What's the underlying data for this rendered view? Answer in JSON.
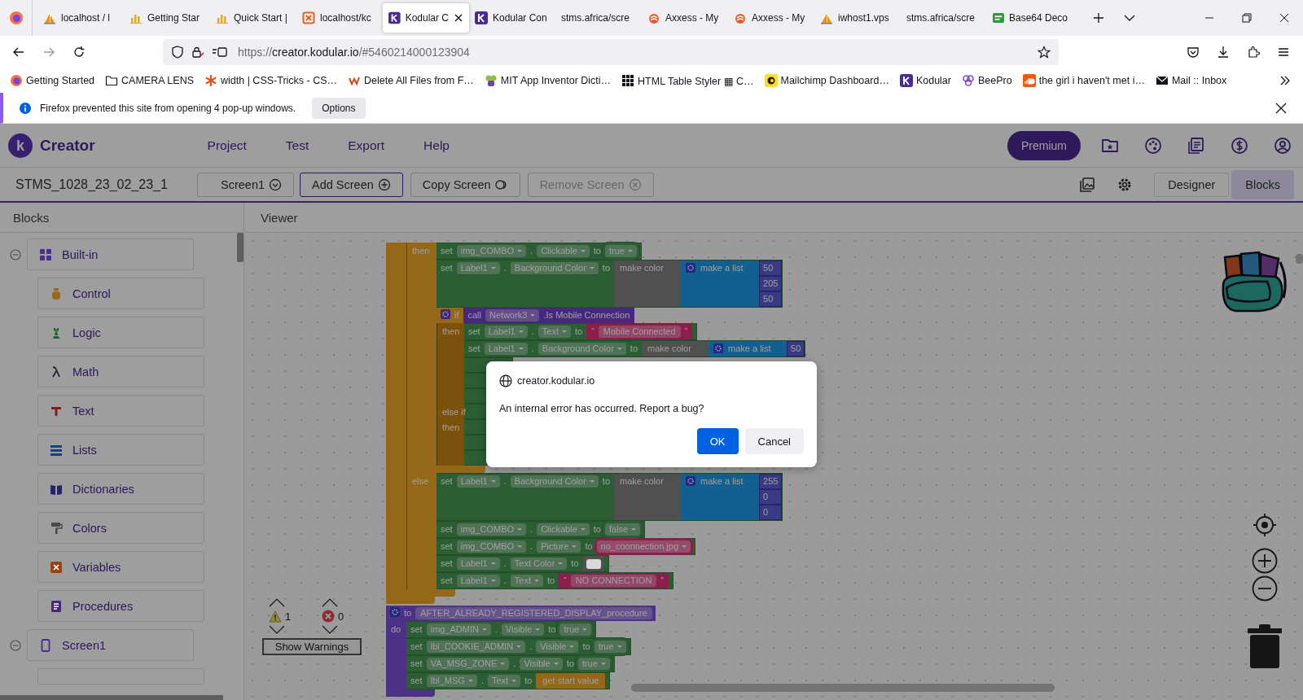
{
  "browser": {
    "tabs": [
      {
        "kind": "pma",
        "title": "localhost / l",
        "selected": false
      },
      {
        "kind": "chart",
        "title": "Getting Star",
        "selected": false
      },
      {
        "kind": "chart",
        "title": "Quick Start |",
        "selected": false
      },
      {
        "kind": "box",
        "title": "localhost/kc",
        "selected": false
      },
      {
        "kind": "kodular",
        "title": "Kodular C",
        "selected": true
      },
      {
        "kind": "kodular",
        "title": "Kodular Con",
        "selected": false
      },
      {
        "kind": "none",
        "title": "stms.africa/scre",
        "selected": false
      },
      {
        "kind": "flame",
        "title": "Axxess - My",
        "selected": false
      },
      {
        "kind": "flame",
        "title": "Axxess - My",
        "selected": false
      },
      {
        "kind": "pma",
        "title": "iwhost1.vps",
        "selected": false
      },
      {
        "kind": "none",
        "title": "stms.africa/scre",
        "selected": false
      },
      {
        "kind": "b64",
        "title": "Base64 Deco",
        "selected": false
      }
    ],
    "url": {
      "scheme": "https://",
      "domain": "creator.kodular.io",
      "path": "/#5460214000123904"
    },
    "bookmarks": [
      {
        "kind": "firefox",
        "label": "Getting Started"
      },
      {
        "kind": "folder",
        "label": "CAMERA LENS"
      },
      {
        "kind": "star",
        "label": "width | CSS-Tricks - CS…"
      },
      {
        "kind": "cw",
        "label": "Delete All Files from F…"
      },
      {
        "kind": "mit",
        "label": "MIT App Inventor Dicti…"
      },
      {
        "kind": "grid",
        "label": "HTML Table Styler ▦ C…"
      },
      {
        "kind": "mailchimp",
        "label": "Mailchimp Dashboard…"
      },
      {
        "kind": "kodular",
        "label": "Kodular"
      },
      {
        "kind": "beepro",
        "label": "BeePro"
      },
      {
        "kind": "soundcloud",
        "label": "the girl i haven't met i…"
      },
      {
        "kind": "mail",
        "label": "Mail :: Inbox"
      }
    ],
    "notice": {
      "text": "Firefox prevented this site from opening 4 pop-up windows.",
      "button": "Options"
    }
  },
  "app": {
    "logo": "k",
    "title": "Creator",
    "menu": [
      "Project",
      "Test",
      "Export",
      "Help"
    ],
    "premium": "Premium",
    "project": "STMS_1028_23_02_23_1",
    "screen_buttons": [
      {
        "kind": "dropdown",
        "label": "Screen1",
        "focused": false,
        "disabled": false
      },
      {
        "kind": "add",
        "label": "Add Screen",
        "focused": true,
        "disabled": false
      },
      {
        "kind": "copy",
        "label": "Copy Screen",
        "focused": false,
        "disabled": false
      },
      {
        "kind": "remove",
        "label": "Remove Screen",
        "focused": false,
        "disabled": true
      }
    ],
    "view_tabs": [
      {
        "label": "Designer",
        "selected": false
      },
      {
        "label": "Blocks",
        "selected": true
      }
    ]
  },
  "blocks_panel": {
    "title": "Blocks",
    "tree": [
      {
        "label": "Built-in",
        "expanded": true,
        "children": [
          {
            "kind": "control",
            "label": "Control",
            "color": "#95681e"
          },
          {
            "kind": "logic",
            "label": "Logic",
            "color": "#256328"
          },
          {
            "kind": "math",
            "label": "Math",
            "color": "#24242e"
          },
          {
            "kind": "text",
            "label": "Text",
            "color": "#811e1e"
          },
          {
            "kind": "lists",
            "label": "Lists",
            "color": "#144577"
          },
          {
            "kind": "dictionaries",
            "label": "Dictionaries",
            "color": "#242468"
          },
          {
            "kind": "colors",
            "label": "Colors",
            "color": "#4a4a4a"
          },
          {
            "kind": "variables",
            "label": "Variables",
            "color": "#954514"
          },
          {
            "kind": "procedures",
            "label": "Procedures",
            "color": "#452877"
          }
        ]
      },
      {
        "label": "Screen1",
        "expanded": true
      }
    ]
  },
  "viewer": {
    "title": "Viewer",
    "scripts": [
      {
        "kind": "event",
        "sections": [
          {
            "statements": [
              {
                "kind": "if",
                "sections": [
                  {
                    "label": "then",
                    "statements": [
                      {
                        "kind": "set",
                        "verb": "set",
                        "component": "img_COMBO",
                        "dot": ".",
                        "property": "Clickable",
                        "to": "to",
                        "value": {
                          "kind": "logic",
                          "text": "true"
                        }
                      },
                      {
                        "kind": "set",
                        "verb": "set",
                        "component": "Label1",
                        "dot": ".",
                        "property": "Background Color",
                        "to": "to",
                        "value": {
                          "kind": "make_color",
                          "text": "make color",
                          "list": {
                            "text": "make a list",
                            "items": [
                              "50",
                              "205",
                              "50"
                            ]
                          }
                        }
                      },
                      {
                        "kind": "if",
                        "keyword": "if",
                        "condition": {
                          "verb": "call",
                          "component": "Network3",
                          "method": ".Is Mobile Connection"
                        },
                        "sections": [
                          {
                            "label": "then",
                            "statements": [
                              {
                                "kind": "set",
                                "verb": "set",
                                "component": "Label1",
                                "dot": ".",
                                "property": "Text",
                                "to": "to",
                                "value": {
                                  "kind": "text",
                                  "quotes": [
                                    "“",
                                    "”"
                                  ],
                                  "text": "Mobile Connected"
                                }
                              },
                              {
                                "kind": "set",
                                "verb": "set",
                                "component": "Label1",
                                "dot": ".",
                                "property": "Background Color",
                                "to": "to",
                                "value": {
                                  "kind": "make_color",
                                  "text": "make color",
                                  "list": {
                                    "text": "make a list",
                                    "items": [
                                      "50"
                                    ]
                                  }
                                }
                              },
                              {
                                "kind": "stub"
                              },
                              {
                                "kind": "stub"
                              },
                              {
                                "kind": "stub"
                              }
                            ]
                          },
                          {
                            "label": "else if",
                            "statements": [
                              {
                                "kind": "stub"
                              }
                            ]
                          },
                          {
                            "label": "then",
                            "statements": [
                              {
                                "kind": "stub"
                              },
                              {
                                "kind": "stub"
                              },
                              {
                                "kind": "stub"
                              }
                            ]
                          }
                        ]
                      }
                    ]
                  },
                  {
                    "label": "else",
                    "statements": [
                      {
                        "kind": "set",
                        "verb": "set",
                        "component": "Label1",
                        "dot": ".",
                        "property": "Background Color",
                        "to": "to",
                        "value": {
                          "kind": "make_color",
                          "text": "make color",
                          "list": {
                            "text": "make a list",
                            "items": [
                              "255",
                              "0",
                              "0"
                            ]
                          }
                        }
                      },
                      {
                        "kind": "set",
                        "verb": "set",
                        "component": "img_COMBO",
                        "dot": ".",
                        "property": "Clickable",
                        "to": "to",
                        "value": {
                          "kind": "logic",
                          "text": "false"
                        }
                      },
                      {
                        "kind": "set",
                        "verb": "set",
                        "component": "img_COMBO",
                        "dot": ".",
                        "property": "Picture",
                        "to": "to",
                        "value": {
                          "kind": "asset",
                          "text": "no_coonnection.jpg"
                        }
                      },
                      {
                        "kind": "set",
                        "verb": "set",
                        "component": "Label1",
                        "dot": ".",
                        "property": "Text Color",
                        "to": "to",
                        "value": {
                          "kind": "color",
                          "color": "#d9d9d9"
                        }
                      },
                      {
                        "kind": "set",
                        "verb": "set",
                        "component": "Label1",
                        "dot": ".",
                        "property": "Text",
                        "to": "to",
                        "value": {
                          "kind": "text",
                          "quotes": [
                            "“",
                            "”"
                          ],
                          "text": "NO CONNECTION"
                        }
                      }
                    ]
                  }
                ]
              }
            ]
          }
        ]
      },
      {
        "kind": "procedure",
        "keyword": "to",
        "name": "AFTER_ALREADY_REGISTERED_DISPLAY_procedure",
        "sections": [
          {
            "label": "do",
            "statements": [
              {
                "kind": "set",
                "verb": "set",
                "component": "img_ADMIN",
                "dot": ".",
                "property": "Visible",
                "to": "to",
                "value": {
                  "kind": "logic",
                  "text": "true"
                }
              },
              {
                "kind": "set",
                "verb": "set",
                "component": "lbl_COOKIE_ADMIN",
                "dot": ".",
                "property": "Visible",
                "to": "to",
                "value": {
                  "kind": "logic",
                  "text": "true"
                }
              },
              {
                "kind": "set",
                "verb": "set",
                "component": "VA_MSG_ZONE",
                "dot": ".",
                "property": "Visible",
                "to": "to",
                "value": {
                  "kind": "logic",
                  "text": "true"
                }
              },
              {
                "kind": "set",
                "verb": "set",
                "component": "lbl_MSG",
                "dot": ".",
                "property": "Text",
                "to": "to",
                "value": {
                  "kind": "get",
                  "text": "get start value"
                }
              }
            ]
          }
        ]
      }
    ],
    "warnings": {
      "warning_count": "1",
      "error_count": "0",
      "button": "Show Warnings"
    }
  },
  "dialog": {
    "origin": "creator.kodular.io",
    "message": "An internal error has occurred. Report a bug?",
    "buttons": [
      {
        "label": "OK",
        "primary": true
      },
      {
        "label": "Cancel",
        "primary": false
      }
    ]
  }
}
